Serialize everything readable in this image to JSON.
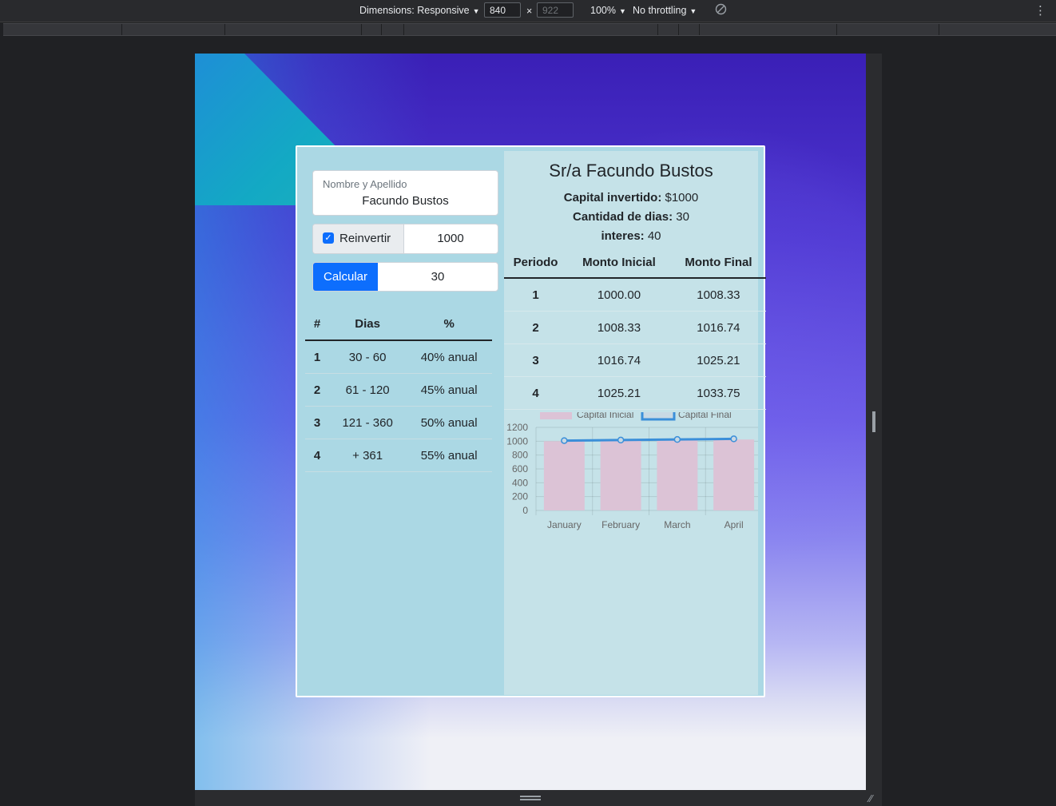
{
  "devtools": {
    "dimensions_label": "Dimensions: Responsive",
    "width_value": "840",
    "height_value": "922",
    "times": "×",
    "zoom": "100%",
    "throttling": "No throttling"
  },
  "form": {
    "name_label": "Nombre y Apellido",
    "name_value": "Facundo Bustos",
    "reinvest_checked": true,
    "reinvest_label": "Reinvertir",
    "amount_value": "1000",
    "calc_button": "Calcular",
    "days_value": "30"
  },
  "rates": {
    "headers": [
      "#",
      "Dias",
      "%"
    ],
    "rows": [
      [
        "1",
        "30 - 60",
        "40% anual"
      ],
      [
        "2",
        "61 - 120",
        "45% anual"
      ],
      [
        "3",
        "121 - 360",
        "50% anual"
      ],
      [
        "4",
        "+ 361",
        "55% anual"
      ]
    ]
  },
  "summary": {
    "title": "Sr/a Facundo Bustos",
    "capital_label": "Capital invertido:",
    "capital_value": "$1000",
    "days_label": "Cantidad de dias:",
    "days_value": "30",
    "interest_label": "interes:",
    "interest_value": "40"
  },
  "results": {
    "headers": [
      "Periodo",
      "Monto Inicial",
      "Monto Final"
    ],
    "rows": [
      [
        "1",
        "1000.00",
        "1008.33"
      ],
      [
        "2",
        "1008.33",
        "1016.74"
      ],
      [
        "3",
        "1016.74",
        "1025.21"
      ],
      [
        "4",
        "1025.21",
        "1033.75"
      ]
    ]
  },
  "chart_data": {
    "type": "bar",
    "categories": [
      "January",
      "February",
      "March",
      "April"
    ],
    "series": [
      {
        "name": "Capital Inicial",
        "type": "bar",
        "values": [
          1000.0,
          1008.33,
          1016.74,
          1025.21
        ],
        "color": "#dcc3d6"
      },
      {
        "name": "Capital Final",
        "type": "line",
        "values": [
          1008.33,
          1016.74,
          1025.21,
          1033.75
        ],
        "color": "#3b8fd9"
      }
    ],
    "ylim": [
      0,
      1200
    ],
    "yticks": [
      0,
      200,
      400,
      600,
      800,
      1000,
      1200
    ],
    "grid": true,
    "legend": "top"
  }
}
